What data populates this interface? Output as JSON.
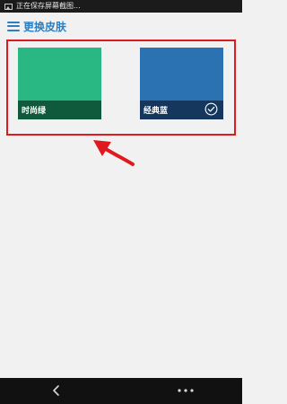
{
  "status_bar": {
    "notification_text": "正在保存屏幕截图...",
    "icon": "image-icon"
  },
  "header": {
    "title": "更换皮肤",
    "menu_icon": "hamburger-menu-icon",
    "accent_color": "#2b7fc0"
  },
  "skins": [
    {
      "label": "时尚绿",
      "color": "#29b784",
      "selected": false
    },
    {
      "label": "经典蓝",
      "color": "#2b72b3",
      "selected": true
    }
  ],
  "annotation": {
    "highlight_color": "#e0191f",
    "arrow_icon": "red-arrow-annotation"
  },
  "nav_bar": {
    "back_icon": "back-chevron-icon",
    "more_icon": "more-dots-icon"
  }
}
